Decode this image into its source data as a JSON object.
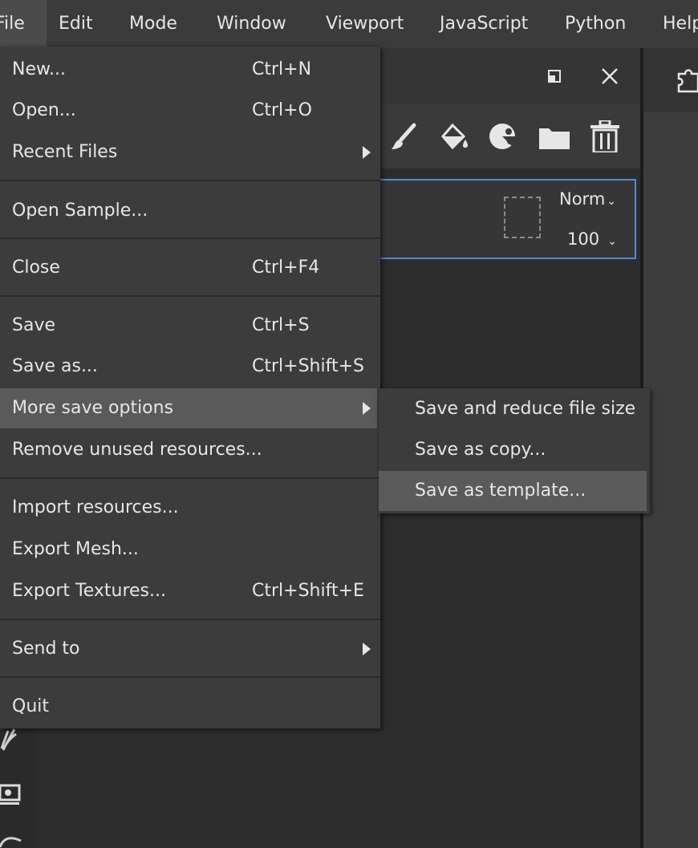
{
  "menubar": {
    "items": [
      "File",
      "Edit",
      "Mode",
      "Window",
      "Viewport",
      "JavaScript",
      "Python",
      "Help"
    ]
  },
  "file_menu": {
    "items": [
      {
        "label": "New...",
        "shortcut": "Ctrl+N"
      },
      {
        "label": "Open...",
        "shortcut": "Ctrl+O"
      },
      {
        "label": "Recent Files",
        "shortcut": ""
      },
      {
        "label": "Open Sample...",
        "shortcut": ""
      },
      {
        "label": "Close",
        "shortcut": "Ctrl+F4"
      },
      {
        "label": "Save",
        "shortcut": "Ctrl+S"
      },
      {
        "label": "Save as...",
        "shortcut": "Ctrl+Shift+S"
      },
      {
        "label": "More save options",
        "shortcut": ""
      },
      {
        "label": "Remove unused resources...",
        "shortcut": ""
      },
      {
        "label": "Import resources...",
        "shortcut": ""
      },
      {
        "label": "Export Mesh...",
        "shortcut": ""
      },
      {
        "label": "Export Textures...",
        "shortcut": "Ctrl+Shift+E"
      },
      {
        "label": "Send to",
        "shortcut": ""
      },
      {
        "label": "Quit",
        "shortcut": ""
      }
    ]
  },
  "submenu": {
    "items": [
      {
        "label": "Save and reduce file size"
      },
      {
        "label": "Save as copy..."
      },
      {
        "label": "Save as template..."
      }
    ]
  },
  "layer_panel": {
    "blend_mode": "Norm",
    "opacity": "100"
  },
  "colors": {
    "accent": "#4a8fd4",
    "menu_bg": "#3c3c3c",
    "highlight": "#5a5a5a"
  },
  "icons": [
    "float-window-icon",
    "close-icon",
    "paint-brush-icon",
    "fill-bucket-icon",
    "smart-material-icon",
    "folder-icon",
    "trash-icon",
    "puzzle-icon",
    "pen-tool-icon",
    "settings-icon"
  ]
}
